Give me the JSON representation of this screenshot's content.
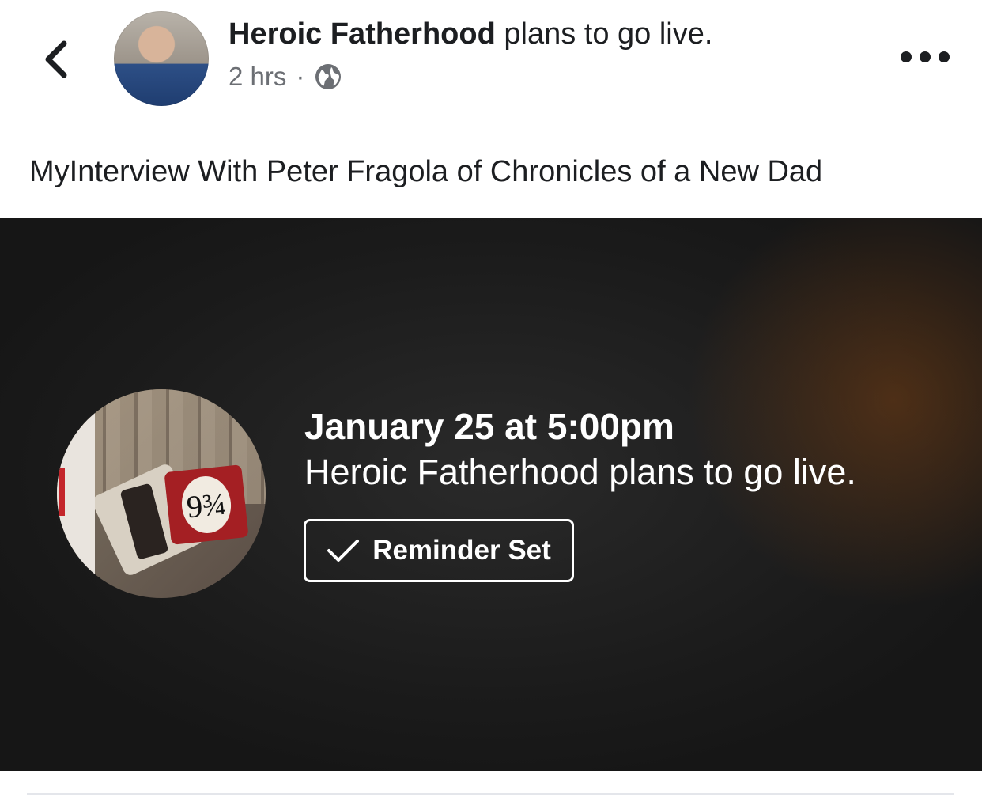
{
  "header": {
    "page_name": "Heroic Fatherhood",
    "action_text": " plans to go live.",
    "timestamp": "2 hrs",
    "separator": "·",
    "privacy_icon": "globe-icon",
    "back_icon": "chevron-left-icon",
    "more_icon": "more-horizontal-icon"
  },
  "post": {
    "text": "MyInterview With Peter Fragola of Chronicles of a New Dad"
  },
  "live_card": {
    "date_time": "January 25 at 5:00pm",
    "subtitle": "Heroic Fatherhood plans to go live.",
    "reminder_label": "Reminder Set",
    "reminder_icon": "checkmark-icon",
    "photo_badge_text": "9¾",
    "background_color": "#1b1b1b",
    "accent_glow": "#78401a"
  },
  "colors": {
    "text_primary": "#1c1e21",
    "text_secondary": "#6c6f74",
    "divider": "#e4e6eb"
  }
}
